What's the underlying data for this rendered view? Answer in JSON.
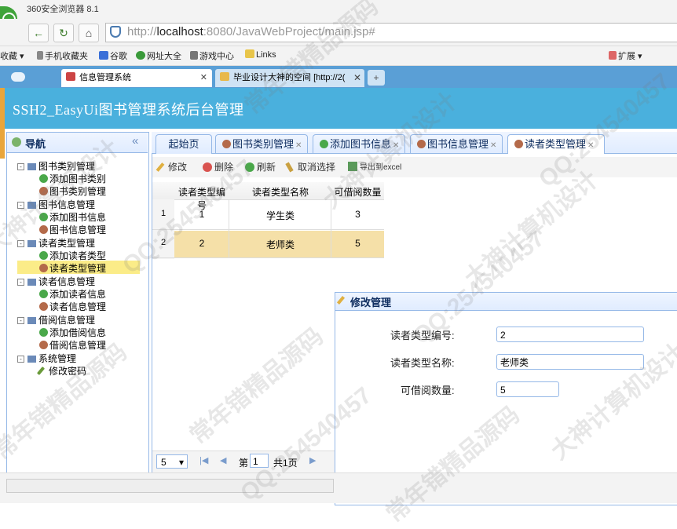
{
  "browser": {
    "window_title": "360安全浏览器 8.1",
    "address_prefix": "http://",
    "address_host": "localhost",
    "address_rest": ":8080/JavaWebProject/main.jsp#",
    "bookmarks": [
      "收藏",
      "手机收藏夹",
      "谷歌",
      "网址大全",
      "游戏中心",
      "Links"
    ],
    "bookmarks_right": [
      "扩展"
    ],
    "tabs": [
      {
        "label": "信息管理系统",
        "active": true
      },
      {
        "label": "毕业设计大神的空间 [http://2(",
        "active": false
      }
    ]
  },
  "app": {
    "title": "SSH2_EasyUi图书管理系统后台管理"
  },
  "nav": {
    "title": "导航",
    "collapse_symbol": "«",
    "groups": [
      {
        "label": "图书类别管理",
        "items": [
          "添加图书类别",
          "图书类别管理"
        ]
      },
      {
        "label": "图书信息管理",
        "items": [
          "添加图书信息",
          "图书信息管理"
        ]
      },
      {
        "label": "读者类型管理",
        "items": [
          "添加读者类型",
          "读者类型管理"
        ]
      },
      {
        "label": "读者信息管理",
        "items": [
          "添加读者信息",
          "读者信息管理"
        ]
      },
      {
        "label": "借阅信息管理",
        "items": [
          "添加借阅信息",
          "借阅信息管理"
        ]
      },
      {
        "label": "系统管理",
        "items": [
          "修改密码"
        ]
      }
    ],
    "selected": "读者类型管理"
  },
  "main_tabs": [
    {
      "label": "起始页",
      "closable": false
    },
    {
      "label": "图书类别管理",
      "closable": true
    },
    {
      "label": "添加图书信息",
      "closable": true
    },
    {
      "label": "图书信息管理",
      "closable": true
    },
    {
      "label": "读者类型管理",
      "closable": true,
      "active": true
    }
  ],
  "toolbar": {
    "edit": "修改",
    "delete": "删除",
    "refresh": "刷新",
    "cancel_select": "取消选择",
    "export": "导出到excel"
  },
  "grid": {
    "columns": [
      "读者类型编号",
      "读者类型名称",
      "可借阅数量"
    ],
    "rows": [
      {
        "num": "1",
        "id": "1",
        "name": "学生类",
        "count": "3"
      },
      {
        "num": "2",
        "id": "2",
        "name": "老师类",
        "count": "5"
      }
    ],
    "selected_row": 2
  },
  "pager": {
    "page_size": "5",
    "page_label": "第",
    "page_value": "1",
    "total_label": "共1页"
  },
  "dialog": {
    "title": "修改管理",
    "fields": [
      {
        "label": "读者类型编号:",
        "value": "2"
      },
      {
        "label": "读者类型名称:",
        "value": "老师类"
      },
      {
        "label": "可借阅数量:",
        "value": "5"
      }
    ]
  },
  "colors": {
    "header_bg": "#4ab0dd",
    "selected_row": "#f5e0a8",
    "tree_selected": "#fbec88",
    "panel_border": "#95b8e7"
  },
  "watermark": [
    "常年错精品源码",
    "QQ:254540457",
    "大神计算机设计"
  ]
}
